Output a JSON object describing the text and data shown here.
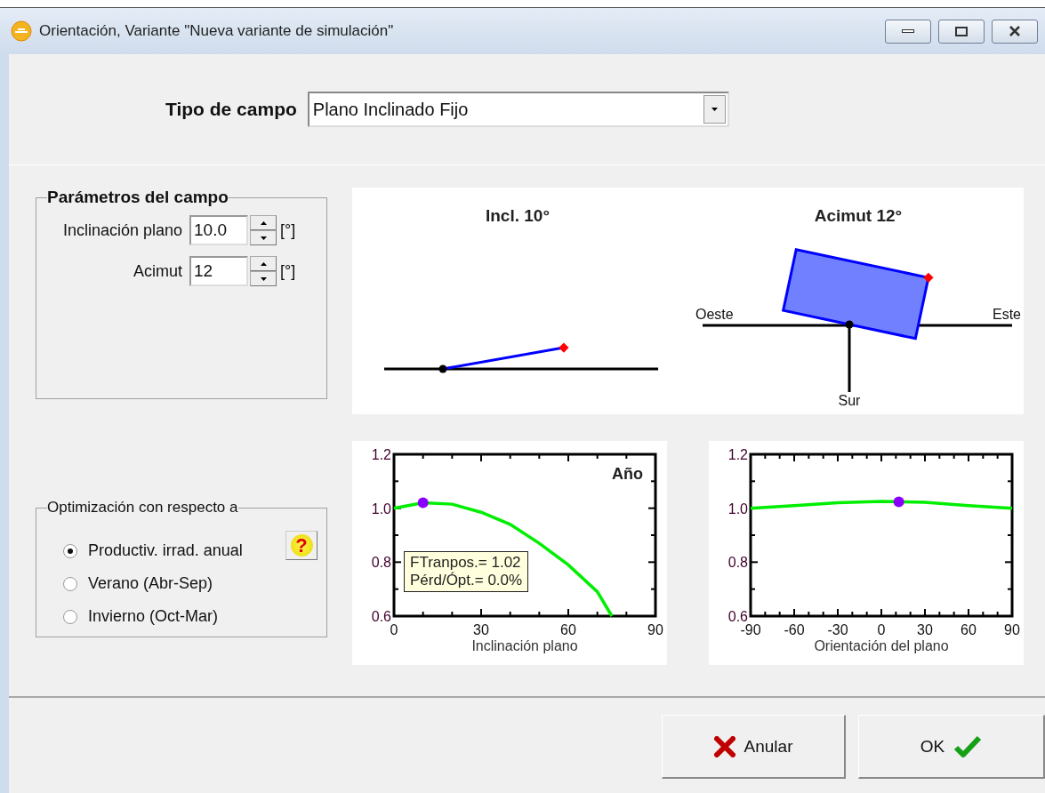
{
  "window": {
    "title": "Orientación, Variante \"Nueva variante de simulación\""
  },
  "field_type": {
    "label": "Tipo de campo",
    "value": "Plano Inclinado Fijo"
  },
  "parameters": {
    "title": "Parámetros del campo",
    "fields": [
      {
        "label": "Inclinación plano",
        "value": "10.0",
        "unit": "[°]"
      },
      {
        "label": "Acimut",
        "value": "12",
        "unit": "[°]"
      }
    ]
  },
  "optimization": {
    "title": "Optimización con respecto a",
    "help_button": {
      "label": "?"
    },
    "options": [
      {
        "label": "Productiv. irrad. anual",
        "selected": true
      },
      {
        "label": "Verano (Abr-Sep)",
        "selected": false
      },
      {
        "label": "Invierno (Oct-Mar)",
        "selected": false
      }
    ]
  },
  "diagrams": {
    "inclination": {
      "title": "Incl. 10°"
    },
    "azimuth": {
      "title": "Acimut 12°",
      "west": "Oeste",
      "east": "Este",
      "south": "Sur"
    }
  },
  "charts": [
    {
      "info_box": [
        "FTranpos.= 1.02",
        "Pérd/Ópt.= 0.0%"
      ],
      "chart_data": {
        "type": "line",
        "title": "Año",
        "xlabel": "Inclinación plano",
        "x": [
          0,
          10,
          20,
          30,
          40,
          50,
          60,
          70,
          75
        ],
        "series": [
          {
            "color": "#00ee00",
            "values": [
              1.0,
              1.02,
              1.015,
              0.985,
              0.94,
              0.87,
              0.79,
              0.69,
              0.6
            ]
          }
        ],
        "xlim": [
          0,
          90
        ],
        "ylim": [
          0.6,
          1.2
        ],
        "xticks": [
          0,
          30,
          60,
          90
        ],
        "yticks": [
          {
            "value": 0.6,
            "label": "0.6"
          },
          {
            "value": 0.8,
            "label": "0.8"
          },
          {
            "value": 1,
            "label": "1.0"
          },
          {
            "value": 1.2,
            "label": "1.2"
          }
        ]
      }
    },
    {
      "chart_data": {
        "type": "line",
        "xlabel": "Orientación del plano",
        "x": [
          -90,
          -60,
          -30,
          0,
          30,
          60,
          90
        ],
        "series": [
          {
            "color": "#00ee00",
            "values": [
              1.0,
              1.01,
              1.02,
              1.025,
              1.022,
              1.01,
              1.0
            ]
          }
        ],
        "xlim": [
          -90,
          90
        ],
        "ylim": [
          0.6,
          1.2
        ],
        "xticks": [
          -90,
          -60,
          -30,
          0,
          30,
          60,
          90
        ],
        "yticks": [
          {
            "value": 0.6,
            "label": "0.6"
          },
          {
            "value": 0.8,
            "label": "0.8"
          },
          {
            "value": 1,
            "label": "1.0"
          },
          {
            "value": 1.2,
            "label": "1.2"
          }
        ]
      }
    }
  ],
  "buttons": [
    {
      "label": "Anular",
      "kind": "cancel"
    },
    {
      "label": "OK",
      "kind": "ok"
    }
  ]
}
